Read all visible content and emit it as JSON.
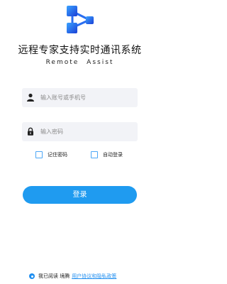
{
  "app": {
    "title": "远程专家支持实时通讯系统",
    "subtitle": "Remote Assist",
    "logo_icon": "cube-network-logo"
  },
  "login_form": {
    "account_placeholder": "输入账号或手机号",
    "account_icon": "user-icon",
    "password_placeholder": "输入密码",
    "password_icon": "lock-icon",
    "remember_password_label": "记住密码",
    "remember_password_checked": false,
    "auto_login_label": "自动登录",
    "auto_login_checked": false,
    "login_button_label": "登录"
  },
  "agreement": {
    "checked": true,
    "text": "我已阅读 境腾",
    "link_text": "用户协议和隐私政策"
  },
  "colors": {
    "accent": "#1f9bf0",
    "field_bg": "#f2f3f7",
    "link": "#1f8ef0"
  }
}
